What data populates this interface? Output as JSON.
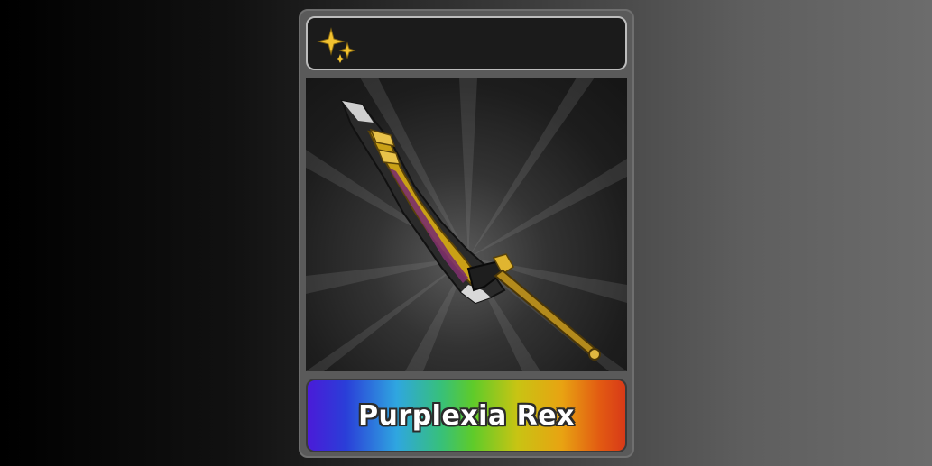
{
  "card": {
    "rarity_icon": "sparkle-icon",
    "item_art": "sword-icon",
    "item_name": "Purplexia Rex"
  },
  "colors": {
    "sparkle": "#f2c230",
    "card_frame": "#5a5a5a",
    "top_bar": "#1b1b1b"
  }
}
